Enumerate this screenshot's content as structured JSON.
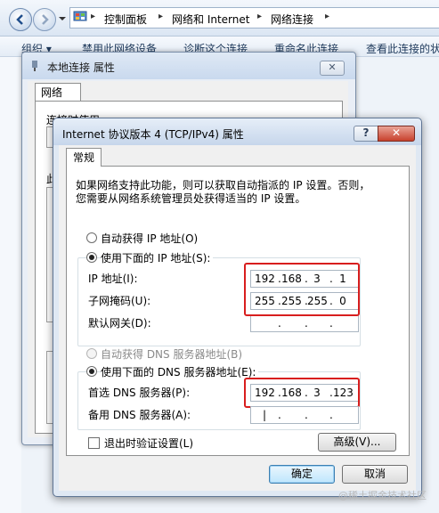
{
  "explorer": {
    "breadcrumb": [
      "控制面板",
      "网络和 Internet",
      "网络连接"
    ],
    "commands": [
      "组织 ▾",
      "禁用此网络设备",
      "诊断这个连接",
      "重命名此连接",
      "查看此连接的状态"
    ]
  },
  "back_dialog": {
    "title": "本地连接 属性",
    "close": "✕",
    "tab": "网络",
    "label_connect_using": "连接时使用:",
    "label_items": "此"
  },
  "dialog": {
    "title": "Internet 协议版本 4 (TCP/IPv4) 属性",
    "help": "?",
    "close": "✕",
    "tab": "常规",
    "description_line1": "如果网络支持此功能，则可以获取自动指派的 IP 设置。否则，",
    "description_line2": "您需要从网络系统管理员处获得适当的 IP 设置。",
    "auto_ip_label": "自动获得 IP 地址(O)",
    "manual_ip_label": "使用下面的 IP 地址(S):",
    "ip_label": "IP 地址(I):",
    "mask_label": "子网掩码(U):",
    "gateway_label": "默认网关(D):",
    "ip_address": [
      "192",
      "168",
      "3",
      "1"
    ],
    "subnet_mask": [
      "255",
      "255",
      "255",
      "0"
    ],
    "gateway": [
      "",
      "",
      "",
      ""
    ],
    "auto_dns_label": "自动获得 DNS 服务器地址(B)",
    "manual_dns_label": "使用下面的 DNS 服务器地址(E):",
    "preferred_dns_label": "首选 DNS 服务器(P):",
    "alternate_dns_label": "备用 DNS 服务器(A):",
    "preferred_dns": [
      "192",
      "168",
      "3",
      "123"
    ],
    "alternate_dns": [
      "|",
      "",
      "",
      ""
    ],
    "validate_on_exit_label": "退出时验证设置(L)",
    "advanced_button": "高级(V)...",
    "ok_button": "确定",
    "cancel_button": "取消"
  },
  "watermark": "@稀土掘金技术社区",
  "colors": {
    "highlight_box": "#d81e1e",
    "close_button": "#c8412c"
  }
}
